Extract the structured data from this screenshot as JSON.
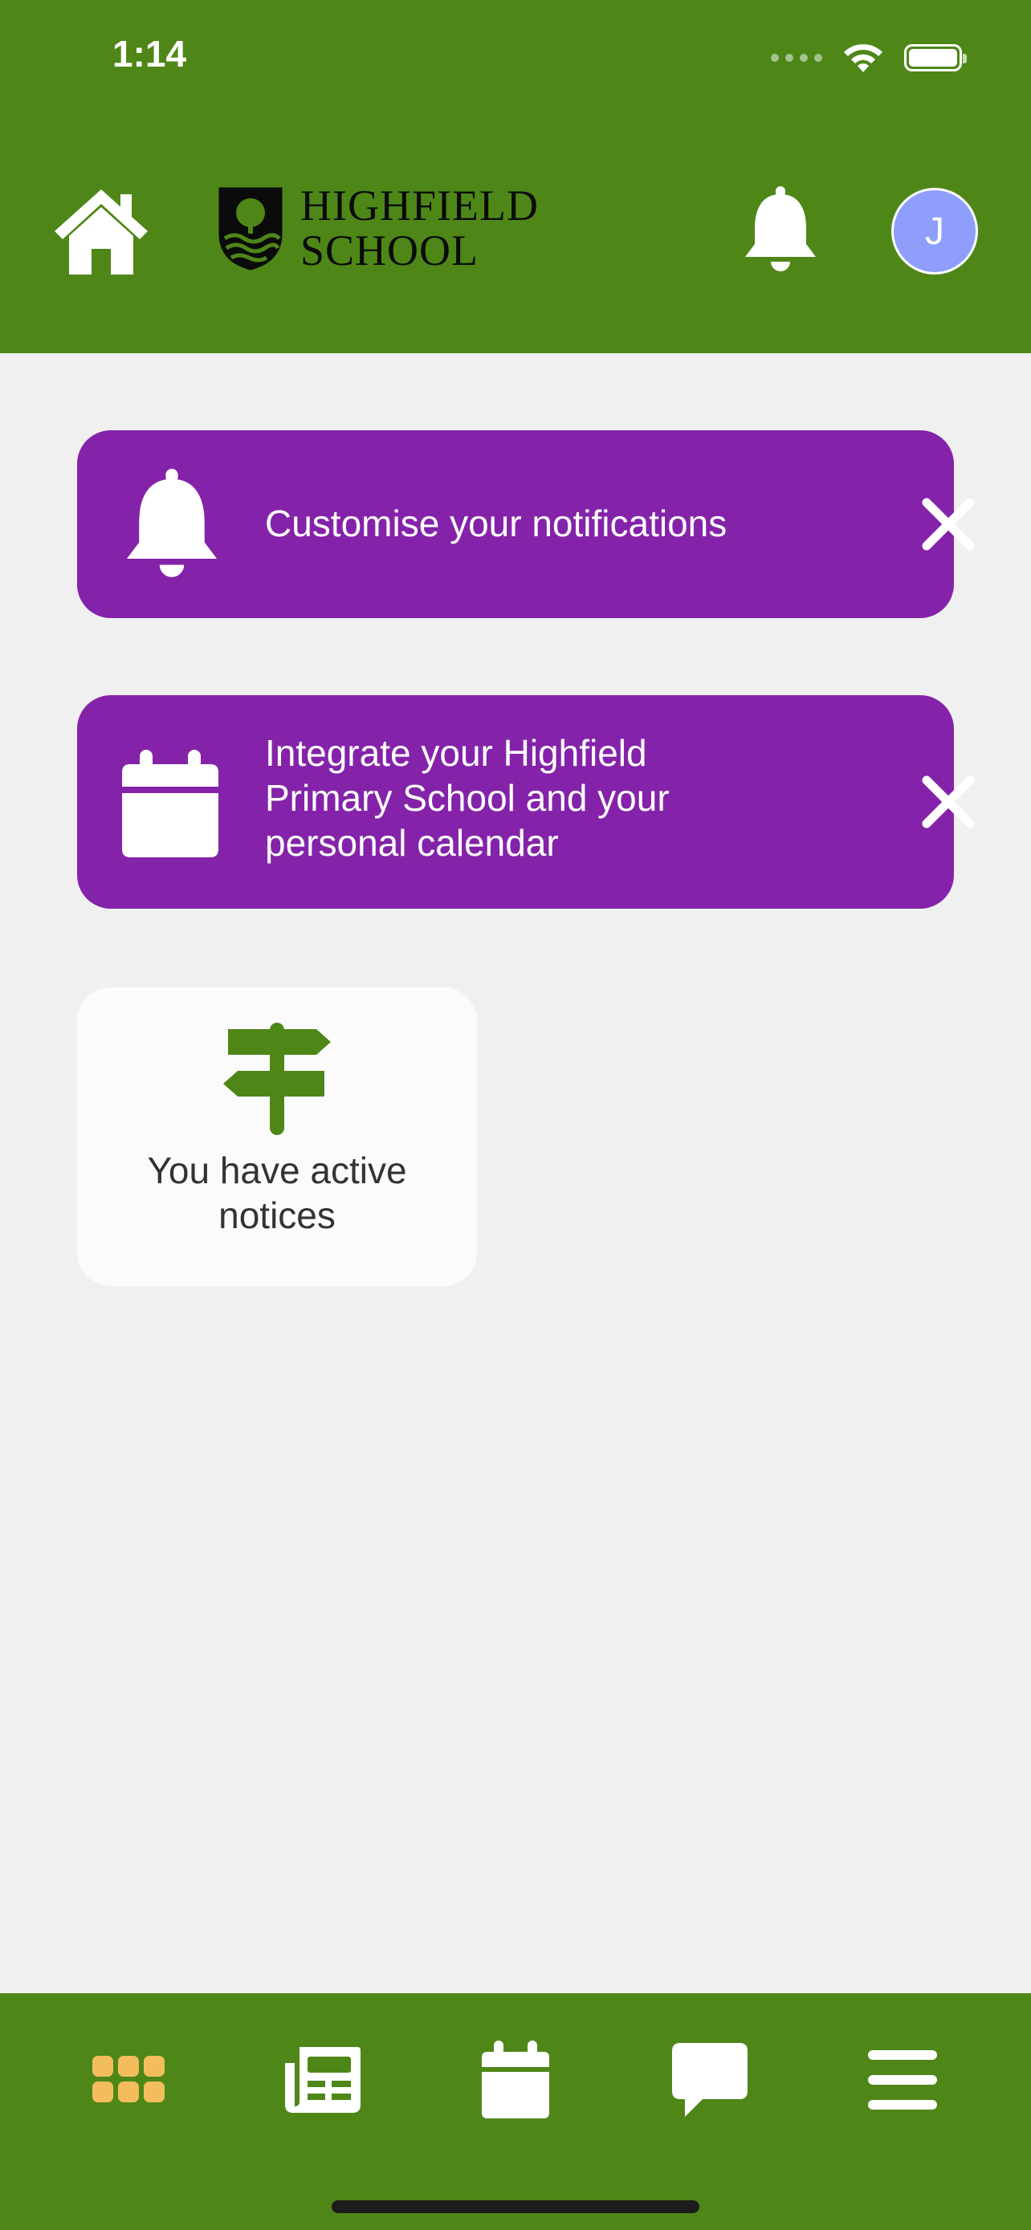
{
  "status_bar": {
    "time": "1:14"
  },
  "header": {
    "logo_line1": "HIGHFIELD",
    "logo_line2": "SCHOOL",
    "avatar_initial": "J"
  },
  "banners": [
    {
      "text": "Customise your notifications",
      "icon": "bell-icon"
    },
    {
      "text": "Integrate your Highfield Primary School and your personal calendar",
      "icon": "calendar-icon"
    }
  ],
  "notice_card": {
    "text": "You have active notices",
    "icon": "signpost-icon"
  },
  "tabbar": {
    "tabs": [
      "grid-icon",
      "newspaper-icon",
      "calendar-icon",
      "chat-icon",
      "menu-icon"
    ]
  },
  "colors": {
    "brand_green": "#4e8718",
    "banner_purple": "#8423aa",
    "active_tab": "#f3bd5d",
    "avatar": "#8e9efa",
    "background": "#f0f0f0"
  }
}
